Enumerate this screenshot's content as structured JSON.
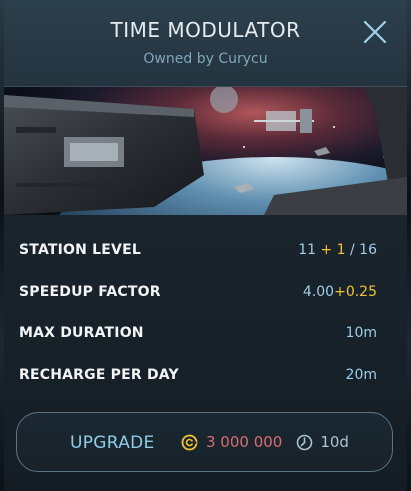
{
  "window": {
    "title": "TIME MODULATOR",
    "subtitle": "Owned by Curycu",
    "close_icon": "close-icon"
  },
  "banner": {
    "description_icon": "space-station-illustration"
  },
  "stats": [
    {
      "label": "STATION LEVEL",
      "value": "11",
      "plus": " + 1",
      "rest": " / 16"
    },
    {
      "label": "SPEEDUP FACTOR",
      "value": "4.00",
      "plus": "+0.25",
      "rest": ""
    },
    {
      "label": "MAX DURATION",
      "value": "10m",
      "plus": "",
      "rest": ""
    },
    {
      "label": "RECHARGE PER DAY",
      "value": "20m",
      "plus": "",
      "rest": ""
    }
  ],
  "upgrade": {
    "label": "UPGRADE",
    "cost_amount": "3 000 000",
    "cost_icon": "currency-icon",
    "time": "10d",
    "time_icon": "clock-icon"
  },
  "colors": {
    "accent_blue": "#8fcde8",
    "bonus_yellow": "#f3c331",
    "cost_red": "#d96b73"
  }
}
